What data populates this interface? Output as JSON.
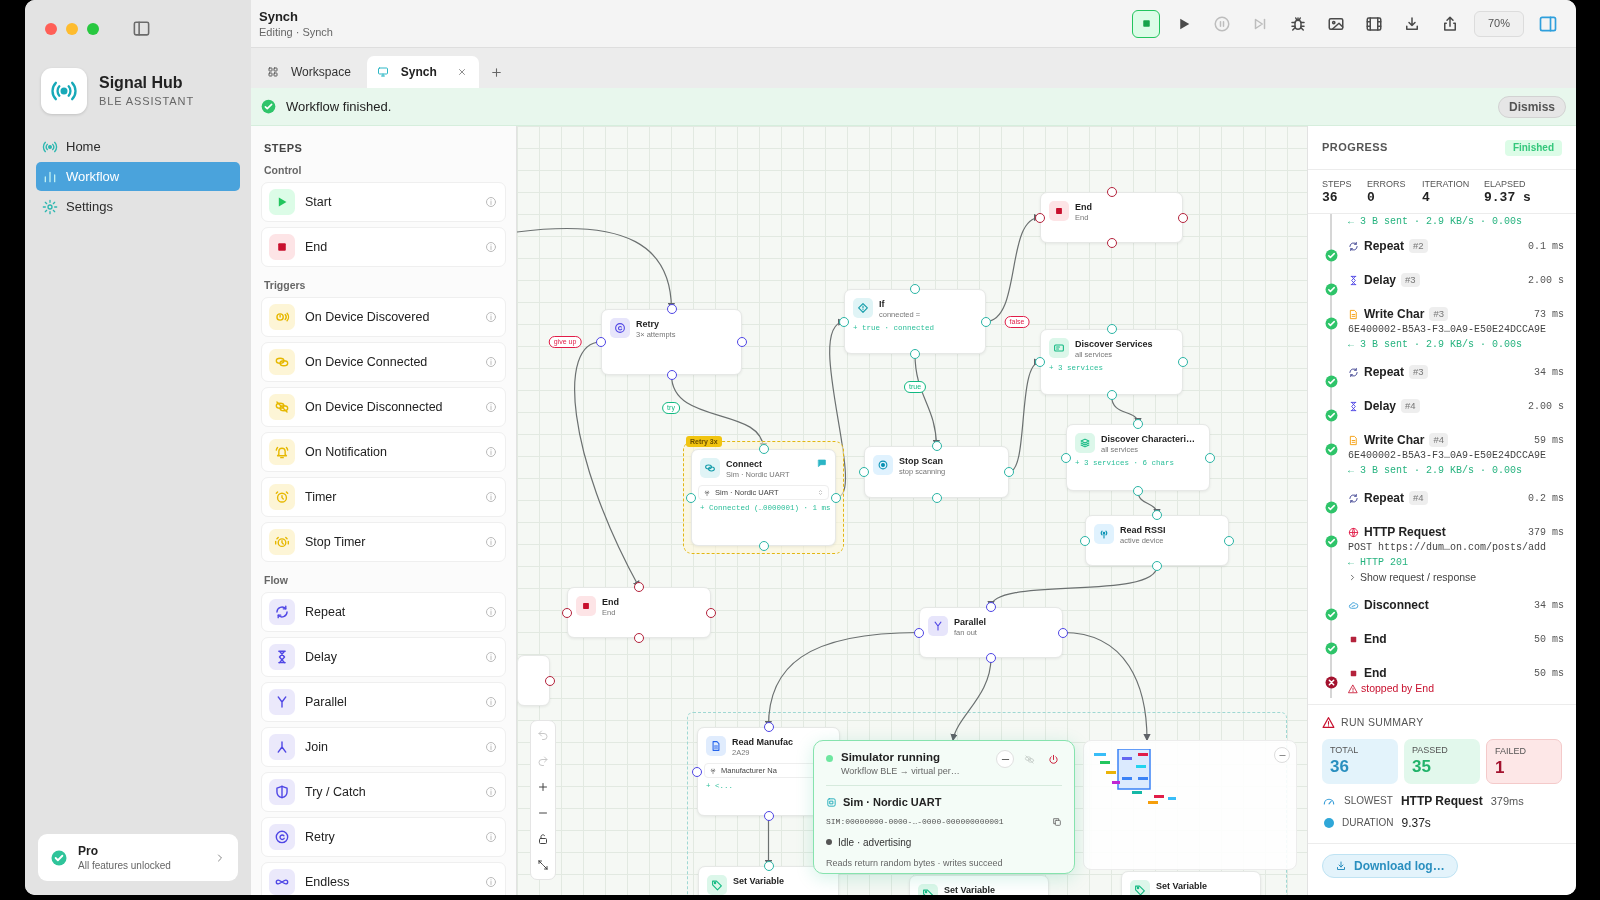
{
  "window": {
    "title": "Synch",
    "subtitle": "Editing · Synch"
  },
  "sidebar": {
    "app_name": "Signal Hub",
    "app_tagline": "BLE ASSISTANT",
    "items": [
      {
        "label": "Home",
        "kind": "home",
        "selected": false
      },
      {
        "label": "Workflow",
        "kind": "workflow",
        "selected": true
      },
      {
        "label": "Settings",
        "kind": "settings",
        "selected": false
      }
    ],
    "plan": {
      "title": "Pro",
      "subtitle": "All features unlocked"
    }
  },
  "toolbar": {
    "buttons": [
      {
        "kind": "stop",
        "active": true,
        "disabled": false
      },
      {
        "kind": "run",
        "active": false,
        "disabled": false
      },
      {
        "kind": "pause",
        "active": false,
        "disabled": true
      },
      {
        "kind": "step",
        "active": false,
        "disabled": true
      },
      {
        "kind": "debug",
        "active": false,
        "disabled": false
      },
      {
        "kind": "media",
        "active": false,
        "disabled": false
      },
      {
        "kind": "video",
        "active": false,
        "disabled": false
      },
      {
        "kind": "export",
        "active": false,
        "disabled": false
      },
      {
        "kind": "share",
        "active": false,
        "disabled": false
      }
    ],
    "zoom": "70%",
    "inspector": {
      "selected": true
    }
  },
  "tabs": [
    {
      "label": "Workspace",
      "kind": "workspace",
      "selected": false,
      "closable": false
    },
    {
      "label": "Synch",
      "kind": "document",
      "selected": true,
      "closable": true
    }
  ],
  "banner": {
    "message": "Workflow finished.",
    "action": "Dismiss"
  },
  "steps": {
    "title": "STEPS",
    "groups": [
      {
        "label": "Control",
        "items": [
          {
            "label": "Start",
            "kind": "start"
          },
          {
            "label": "End",
            "kind": "end"
          }
        ]
      },
      {
        "label": "Triggers",
        "items": [
          {
            "label": "On Device Discovered",
            "kind": "discovered"
          },
          {
            "label": "On Device Connected",
            "kind": "connected"
          },
          {
            "label": "On Device Disconnected",
            "kind": "disconnected"
          },
          {
            "label": "On Notification",
            "kind": "notification"
          },
          {
            "label": "Timer",
            "kind": "timer"
          },
          {
            "label": "Stop Timer",
            "kind": "stop_timer"
          }
        ]
      },
      {
        "label": "Flow",
        "items": [
          {
            "label": "Repeat",
            "kind": "repeat"
          },
          {
            "label": "Delay",
            "kind": "delay"
          },
          {
            "label": "Parallel",
            "kind": "parallel"
          },
          {
            "label": "Join",
            "kind": "join"
          },
          {
            "label": "Try / Catch",
            "kind": "try_catch"
          },
          {
            "label": "Retry",
            "kind": "retry"
          },
          {
            "label": "Endless",
            "kind": "endless"
          }
        ]
      }
    ]
  },
  "canvas": {
    "nodes": [
      {
        "kind": "end",
        "title": "End",
        "subtitle": "End",
        "selected": false,
        "note": false
      },
      {
        "kind": "retry",
        "title": "Retry",
        "subtitle": "3× attempts",
        "selected": false,
        "note": false
      },
      {
        "kind": "if",
        "title": "If",
        "subtitle": "connected =",
        "result": "+ true · connected",
        "selected": false,
        "note": false
      },
      {
        "kind": "discover_services",
        "title": "Discover Services",
        "subtitle": "all services",
        "result": "+ 3 services",
        "selected": false,
        "note": false
      },
      {
        "kind": "connect",
        "title": "Connect",
        "subtitle": "Sim · Nordic UART",
        "device": "Sim · Nordic UART",
        "result": "+ Connected (…0000001) · 1 ms",
        "wrapper": "Retry 3x",
        "selected": true,
        "note": true
      },
      {
        "kind": "stop_scan",
        "title": "Stop Scan",
        "subtitle": "stop scanning",
        "selected": false,
        "note": false
      },
      {
        "kind": "discover_chars",
        "title": "Discover Characteri…",
        "subtitle": "all services",
        "result": "+ 3 services · 6 chars",
        "selected": false,
        "note": false
      },
      {
        "kind": "rssi",
        "title": "Read RSSI",
        "subtitle": "active device",
        "selected": false,
        "note": false
      },
      {
        "kind": "end",
        "title": "End",
        "subtitle": "End",
        "selected": false,
        "note": false
      },
      {
        "kind": "parallel",
        "title": "Parallel",
        "subtitle": "fan out",
        "selected": false,
        "note": false
      },
      {
        "kind": "partial",
        "selected": false,
        "note": false
      },
      {
        "kind": "read",
        "title": "Read Manufac",
        "subtitle": "2A29",
        "device": "Manufacturer Na",
        "result": "+ <...",
        "selected": false,
        "note": false
      },
      {
        "kind": "set_variable",
        "title": "Set Variable",
        "selected": false,
        "note": false
      },
      {
        "kind": "set_variable",
        "title": "Set Variable",
        "selected": false,
        "note": false
      },
      {
        "kind": "set_variable",
        "title": "Set Variable",
        "selected": false,
        "note": false
      }
    ],
    "edge_labels": [
      {
        "text": "give up",
        "color": "#e11d48"
      },
      {
        "text": "try",
        "color": "#10b981"
      },
      {
        "text": "true",
        "color": "#10b981"
      },
      {
        "text": "false",
        "color": "#e11d48"
      }
    ],
    "controls": [
      {
        "kind": "undo",
        "disabled": true
      },
      {
        "kind": "redo",
        "disabled": true
      },
      {
        "kind": "zoom_in",
        "disabled": false
      },
      {
        "kind": "zoom_out",
        "disabled": false
      },
      {
        "kind": "lock",
        "disabled": false
      },
      {
        "kind": "fit",
        "disabled": false
      }
    ],
    "simulator": {
      "title": "Simulator running",
      "running": true,
      "subtitle": "Workflow BLE → virtual per…",
      "buttons": [
        {
          "kind": "minimize",
          "disabled": false
        },
        {
          "kind": "link",
          "disabled": true
        },
        {
          "kind": "power",
          "disabled": false
        }
      ],
      "device": "Sim · Nordic UART",
      "address": "SIM:00000000-0000-…-0000-000000000001",
      "state": "Idle · advertising",
      "note": "Reads return random bytes · writes succeed"
    }
  },
  "progress": {
    "title": "PROGRESS",
    "status": "Finished",
    "stats": [
      {
        "label": "STEPS",
        "value": "36"
      },
      {
        "label": "ERRORS",
        "value": "0"
      },
      {
        "label": "ITERATION",
        "value": "4"
      },
      {
        "label": "ELAPSED",
        "value": "9.37 s"
      }
    ],
    "log": [
      {
        "kind": "detail",
        "lines": [
          {
            "text": "← 3 B sent · 2.9 KB/s · 0.00s",
            "kind": "ok"
          }
        ]
      },
      {
        "kind": "repeat",
        "title": "Repeat",
        "badge": "#2",
        "time": "0.1 ms",
        "failed": false
      },
      {
        "kind": "delay",
        "title": "Delay",
        "badge": "#3",
        "time": "2.00 s",
        "failed": false
      },
      {
        "kind": "write",
        "title": "Write Char",
        "badge": "#3",
        "time": "73 ms",
        "failed": false,
        "lines": [
          {
            "text": "6E400002-B5A3-F3…0A9-E50E24DCCA9E",
            "kind": "plain"
          },
          {
            "text": "← 3 B sent · 2.9 KB/s · 0.00s",
            "kind": "ok"
          }
        ]
      },
      {
        "kind": "repeat",
        "title": "Repeat",
        "badge": "#3",
        "time": "34 ms",
        "failed": false
      },
      {
        "kind": "delay",
        "title": "Delay",
        "badge": "#4",
        "time": "2.00 s",
        "failed": false
      },
      {
        "kind": "write",
        "title": "Write Char",
        "badge": "#4",
        "time": "59 ms",
        "failed": false,
        "lines": [
          {
            "text": "6E400002-B5A3-F3…0A9-E50E24DCCA9E",
            "kind": "plain"
          },
          {
            "text": "← 3 B sent · 2.9 KB/s · 0.00s",
            "kind": "ok"
          }
        ]
      },
      {
        "kind": "repeat",
        "title": "Repeat",
        "badge": "#4",
        "time": "0.2 ms",
        "failed": false
      },
      {
        "kind": "http",
        "title": "HTTP Request",
        "time": "379 ms",
        "failed": false,
        "lines": [
          {
            "text": "POST https://dum…on.com/posts/add",
            "kind": "plain"
          },
          {
            "text": "← HTTP 201",
            "kind": "ok"
          },
          {
            "text": "Show request / response",
            "kind": "toggle"
          }
        ]
      },
      {
        "kind": "disconnect",
        "title": "Disconnect",
        "time": "34 ms",
        "failed": false
      },
      {
        "kind": "end",
        "title": "End",
        "time": "50 ms",
        "failed": false
      },
      {
        "kind": "end",
        "title": "End",
        "time": "50 ms",
        "failed": true,
        "lines": [
          {
            "text": "stopped by End",
            "kind": "error"
          }
        ]
      }
    ]
  },
  "summary": {
    "title": "RUN SUMMARY",
    "tiles": [
      {
        "kind": "total",
        "label": "TOTAL",
        "value": "36"
      },
      {
        "kind": "passed",
        "label": "PASSED",
        "value": "35"
      },
      {
        "kind": "failed",
        "label": "FAILED",
        "value": "1"
      }
    ],
    "slowest": {
      "label": "SLOWEST",
      "name": "HTTP Request",
      "value": "379ms"
    },
    "duration": {
      "label": "DURATION",
      "value": "9.37s"
    },
    "action": "Download log…"
  }
}
